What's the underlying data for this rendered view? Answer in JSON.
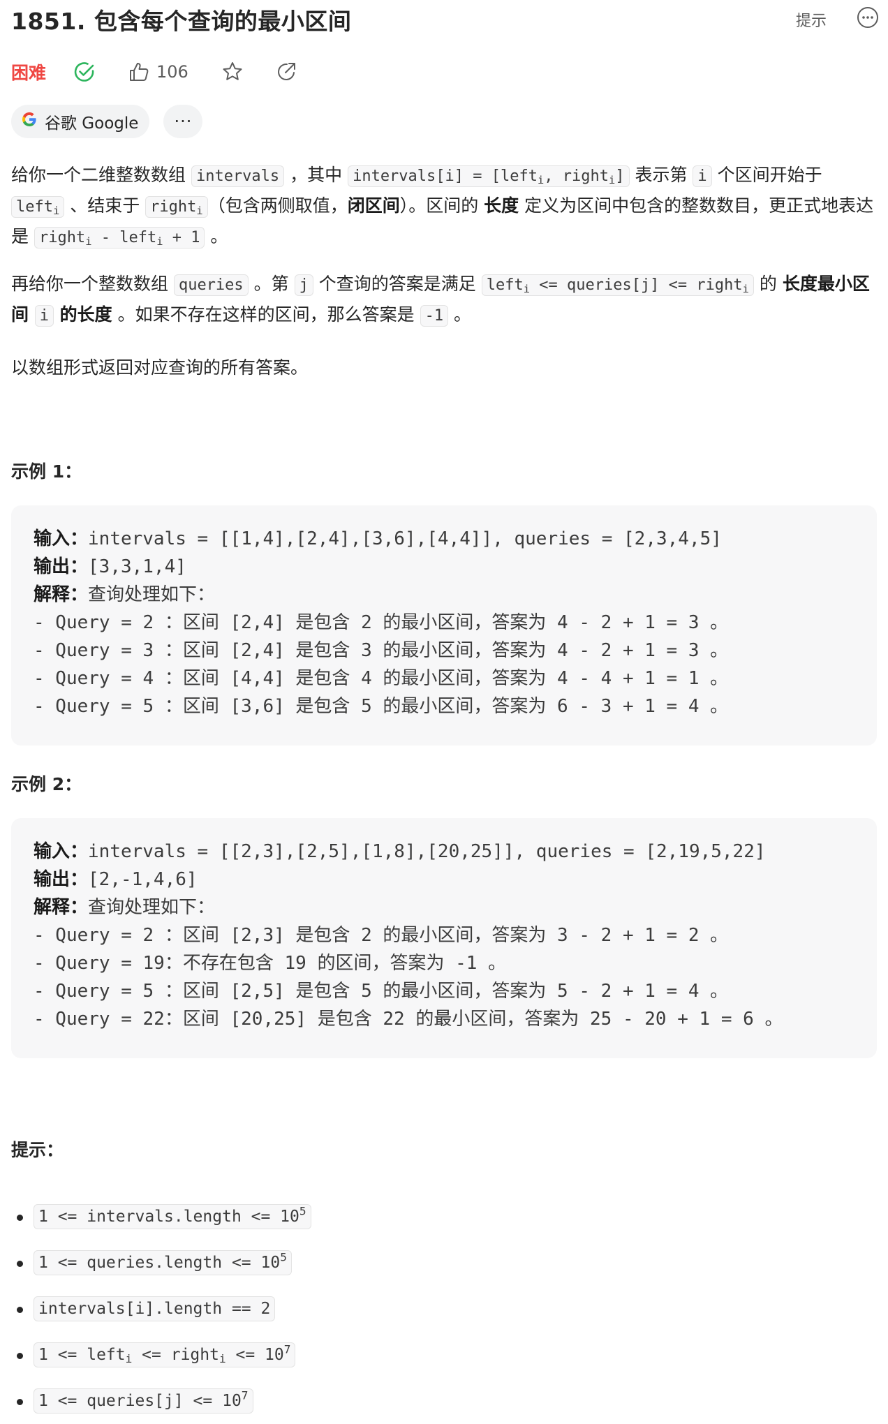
{
  "header": {
    "title": "1851. 包含每个查询的最小区间",
    "hint_label": "提示",
    "difficulty": "困难",
    "like_count": "106",
    "company_tag": "谷歌 Google",
    "more_label": "···"
  },
  "description": {
    "p1": [
      {
        "t": "text",
        "v": "给你一个二维整数数组 "
      },
      {
        "t": "code",
        "v": "intervals"
      },
      {
        "t": "text",
        "v": " ，其中 "
      },
      {
        "t": "code",
        "v": "intervals[i] = [left<sub>i</sub>, right<sub>i</sub>]"
      },
      {
        "t": "text",
        "v": " 表示第 "
      },
      {
        "t": "code",
        "v": "i"
      },
      {
        "t": "text",
        "v": " 个区间开始于 "
      },
      {
        "t": "code",
        "v": "left<sub>i</sub>"
      },
      {
        "t": "text",
        "v": " 、结束于 "
      },
      {
        "t": "code",
        "v": "right<sub>i</sub>"
      },
      {
        "t": "text",
        "v": "（包含两侧取值，"
      },
      {
        "t": "bold",
        "v": "闭区间"
      },
      {
        "t": "text",
        "v": "）。区间的 "
      },
      {
        "t": "bold",
        "v": "长度"
      },
      {
        "t": "text",
        "v": " 定义为区间中包含的整数数目，更正式地表达是 "
      },
      {
        "t": "code",
        "v": "right<sub>i</sub> - left<sub>i</sub> + 1"
      },
      {
        "t": "text",
        "v": " 。"
      }
    ],
    "p2": [
      {
        "t": "text",
        "v": "再给你一个整数数组 "
      },
      {
        "t": "code",
        "v": "queries"
      },
      {
        "t": "text",
        "v": " 。第 "
      },
      {
        "t": "code",
        "v": "j"
      },
      {
        "t": "text",
        "v": " 个查询的答案是满足 "
      },
      {
        "t": "code",
        "v": "left<sub>i</sub> <= queries[j] <= right<sub>i</sub>"
      },
      {
        "t": "text",
        "v": " 的 "
      },
      {
        "t": "bold",
        "v": "长度最小区间 "
      },
      {
        "t": "code",
        "v": "i"
      },
      {
        "t": "bold",
        "v": " 的长度"
      },
      {
        "t": "text",
        "v": " 。如果不存在这样的区间，那么答案是 "
      },
      {
        "t": "code",
        "v": "-1"
      },
      {
        "t": "text",
        "v": " 。"
      }
    ],
    "p3": "以数组形式返回对应查询的所有答案。"
  },
  "examples": [
    {
      "heading": "示例 1：",
      "input_label": "输入：",
      "input": "intervals = [[1,4],[2,4],[3,6],[4,4]], queries = [2,3,4,5]",
      "output_label": "输出：",
      "output": "[3,3,1,4]",
      "explain_label": "解释：",
      "explain": "查询处理如下：",
      "lines": [
        "- Query = 2 ：区间 [2,4] 是包含 2 的最小区间，答案为 4 - 2 + 1 = 3 。",
        "- Query = 3 ：区间 [2,4] 是包含 3 的最小区间，答案为 4 - 2 + 1 = 3 。",
        "- Query = 4 ：区间 [4,4] 是包含 4 的最小区间，答案为 4 - 4 + 1 = 1 。",
        "- Query = 5 ：区间 [3,6] 是包含 5 的最小区间，答案为 6 - 3 + 1 = 4 。"
      ]
    },
    {
      "heading": "示例 2：",
      "input_label": "输入：",
      "input": "intervals = [[2,3],[2,5],[1,8],[20,25]], queries = [2,19,5,22]",
      "output_label": "输出：",
      "output": "[2,-1,4,6]",
      "explain_label": "解释：",
      "explain": "查询处理如下：",
      "lines": [
        "- Query = 2 ：区间 [2,3] 是包含 2 的最小区间，答案为 3 - 2 + 1 = 2 。",
        "- Query = 19：不存在包含 19 的区间，答案为 -1 。",
        "- Query = 5 ：区间 [2,5] 是包含 5 的最小区间，答案为 5 - 2 + 1 = 4 。",
        "- Query = 22：区间 [20,25] 是包含 22 的最小区间，答案为 25 - 20 + 1 = 6 。"
      ]
    }
  ],
  "constraints": {
    "heading": "提示：",
    "items": [
      "1 <= intervals.length <= 10<sup>5</sup>",
      "1 <= queries.length <= 10<sup>5</sup>",
      "intervals[i].length == 2",
      "1 <= left<sub>i</sub> <= right<sub>i</sub> <= 10<sup>7</sup>",
      "1 <= queries[j] <= 10<sup>7</sup>"
    ]
  },
  "colors": {
    "difficulty": "#ef4743",
    "solved": "#2db55d",
    "icon": "#5c5c5c"
  }
}
